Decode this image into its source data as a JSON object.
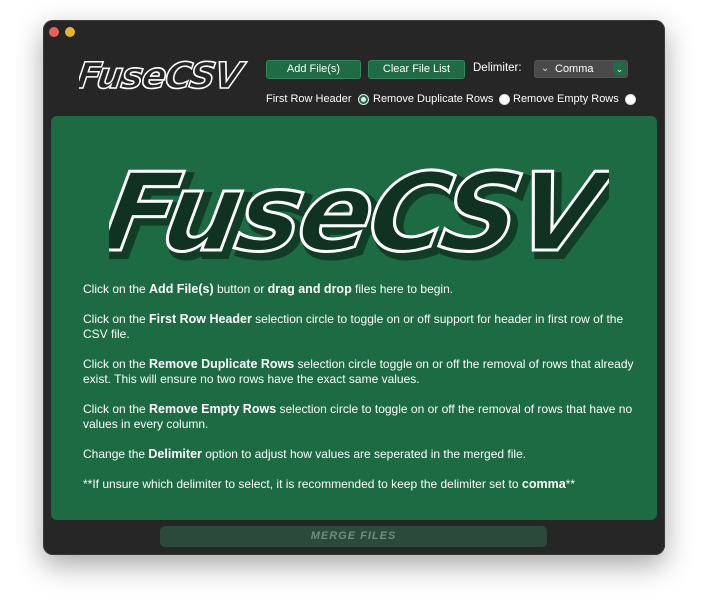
{
  "app": {
    "logo_text": "FuseCSV"
  },
  "toolbar": {
    "add_files_label": "Add File(s)",
    "clear_list_label": "Clear File List",
    "delimiter_label": "Delimiter:",
    "delimiter_value": "Comma"
  },
  "options": {
    "first_row_header": {
      "label": "First Row Header",
      "checked": true
    },
    "remove_duplicates": {
      "label": "Remove Duplicate Rows",
      "checked": false
    },
    "remove_empty": {
      "label": "Remove Empty Rows",
      "checked": false
    }
  },
  "instructions": [
    {
      "pre": "Click on the ",
      "b1": "Add File(s)",
      "mid": " button or ",
      "b2": "drag and drop",
      "post": " files here to begin."
    },
    {
      "pre": "Click on the ",
      "b1": "First Row Header",
      "post": " selection circle to toggle on or off support for header in first row of the CSV file."
    },
    {
      "pre": "Click on the ",
      "b1": "Remove Duplicate Rows",
      "post": " selection circle toggle on or off the removal of rows that already exist. This will ensure no two rows have the exact same values."
    },
    {
      "pre": "Click on the ",
      "b1": "Remove Empty Rows",
      "post": " selection circle to toggle on or off the removal of  rows that have no values in every column."
    },
    {
      "pre": "Change the ",
      "b1": "Delimiter",
      "post": " option to adjust how values are seperated in the merged file."
    },
    {
      "pre": "**If unsure which delimiter to select, it is recommended to keep the delimiter set to ",
      "b1": "comma",
      "post": "**"
    }
  ],
  "merge_label": "MERGE FILES",
  "colors": {
    "panel_green": "#1c6b42",
    "button_green": "#1e6b44",
    "window_bg": "#262626"
  }
}
